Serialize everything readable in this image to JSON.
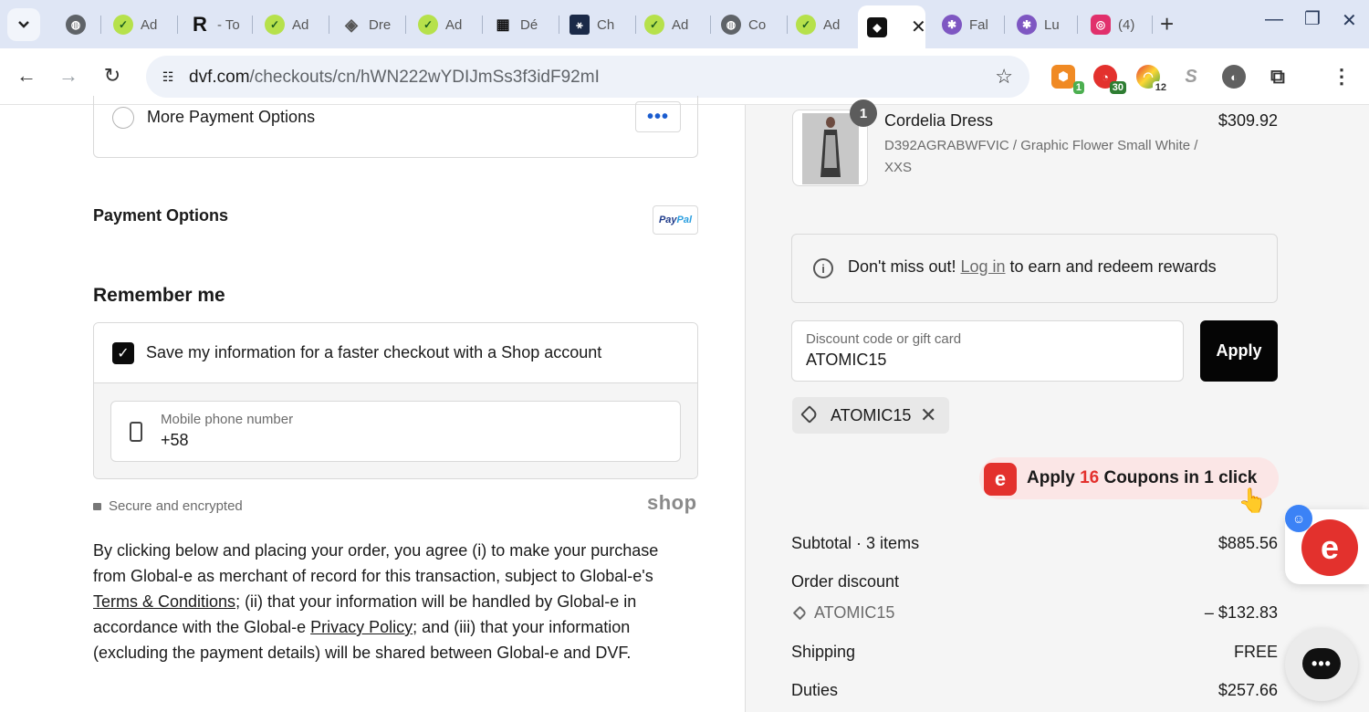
{
  "browser": {
    "tabs": [
      {
        "label": "",
        "icon": "globe-icon"
      },
      {
        "label": "Ad",
        "icon": "checkmark-green-icon"
      },
      {
        "label": "- To",
        "icon": "r-letter-icon"
      },
      {
        "label": "Ad",
        "icon": "checkmark-green-icon"
      },
      {
        "label": "Dre",
        "icon": "diamond-icon"
      },
      {
        "label": "Ad",
        "icon": "checkmark-green-icon"
      },
      {
        "label": "Dé",
        "icon": "pattern-icon"
      },
      {
        "label": "Ch",
        "icon": "figure-icon"
      },
      {
        "label": "Ad",
        "icon": "checkmark-green-icon"
      },
      {
        "label": "Co",
        "icon": "globe-icon"
      },
      {
        "label": "Ad",
        "icon": "checkmark-green-icon"
      },
      {
        "label": "",
        "icon": "dvf-logo-icon",
        "active": true
      },
      {
        "label": "Fal",
        "icon": "purple-gear-icon"
      },
      {
        "label": "Lu",
        "icon": "purple-gear-icon"
      },
      {
        "label": "(4)",
        "icon": "instagram-icon"
      }
    ],
    "url_host": "dvf.com",
    "url_path": "/checkouts/cn/hWN222wYDIJmSs3f3idF92mI",
    "extensions": [
      {
        "badge": "1",
        "color": "#f08a24"
      },
      {
        "badge": "30",
        "color": "#e3312d"
      },
      {
        "badge": "12",
        "color": "#7cb342"
      },
      {
        "badge": "",
        "color": "#9e9e9e",
        "label": "S"
      },
      {
        "badge": "",
        "color": "#616161"
      }
    ]
  },
  "payment": {
    "more_options_label": "More Payment Options",
    "more_options_dots": "•••",
    "payment_options_heading": "Payment Options",
    "paypal_part1": "Pay",
    "paypal_part2": "Pal"
  },
  "remember": {
    "heading": "Remember me",
    "save_label": "Save my information for a faster checkout with a Shop account",
    "phone_placeholder": "Mobile phone number",
    "phone_value": "+58",
    "secure_text": "Secure and encrypted",
    "shop_logo": "shop"
  },
  "legal": {
    "part1": "By clicking below and placing your order, you agree (i) to make your purchase from Global-e as merchant of record for this transaction, subject to Global-e's ",
    "terms_link": "Terms & Conditions",
    "part2": "; (ii) that your information will be handled by Global-e in accordance with the Global-e ",
    "privacy_link": "Privacy Policy",
    "part3": "; and (iii) that your information (excluding the payment details) will be shared between Global-e and DVF."
  },
  "order": {
    "quantity_badge": "1",
    "product_name": "Cordelia Dress",
    "product_variant": "D392AGRABWFVIC / Graphic Flower Small White / XXS",
    "product_price": "$309.92",
    "rewards_prefix": "Don't miss out! ",
    "rewards_link": "Log in",
    "rewards_suffix": " to earn and redeem rewards",
    "discount_placeholder": "Discount code or gift card",
    "discount_value": "ATOMIC15",
    "apply_label": "Apply",
    "applied_code": "ATOMIC15",
    "coupon_prefix": "Apply ",
    "coupon_count": "16",
    "coupon_suffix": " Coupons in 1 click",
    "subtotal_label": "Subtotal · 3 items",
    "subtotal_value": "$885.56",
    "order_discount_label": "Order discount",
    "discount_code_label": "ATOMIC15",
    "discount_amount": "– $132.83",
    "shipping_label": "Shipping",
    "shipping_value": "FREE",
    "duties_label": "Duties",
    "duties_value": "$257.66"
  },
  "colors": {
    "accent_black": "#050505",
    "coupon_red": "#e3312d",
    "paypal_dark": "#1f3b8a",
    "paypal_light": "#2b9fe0"
  }
}
